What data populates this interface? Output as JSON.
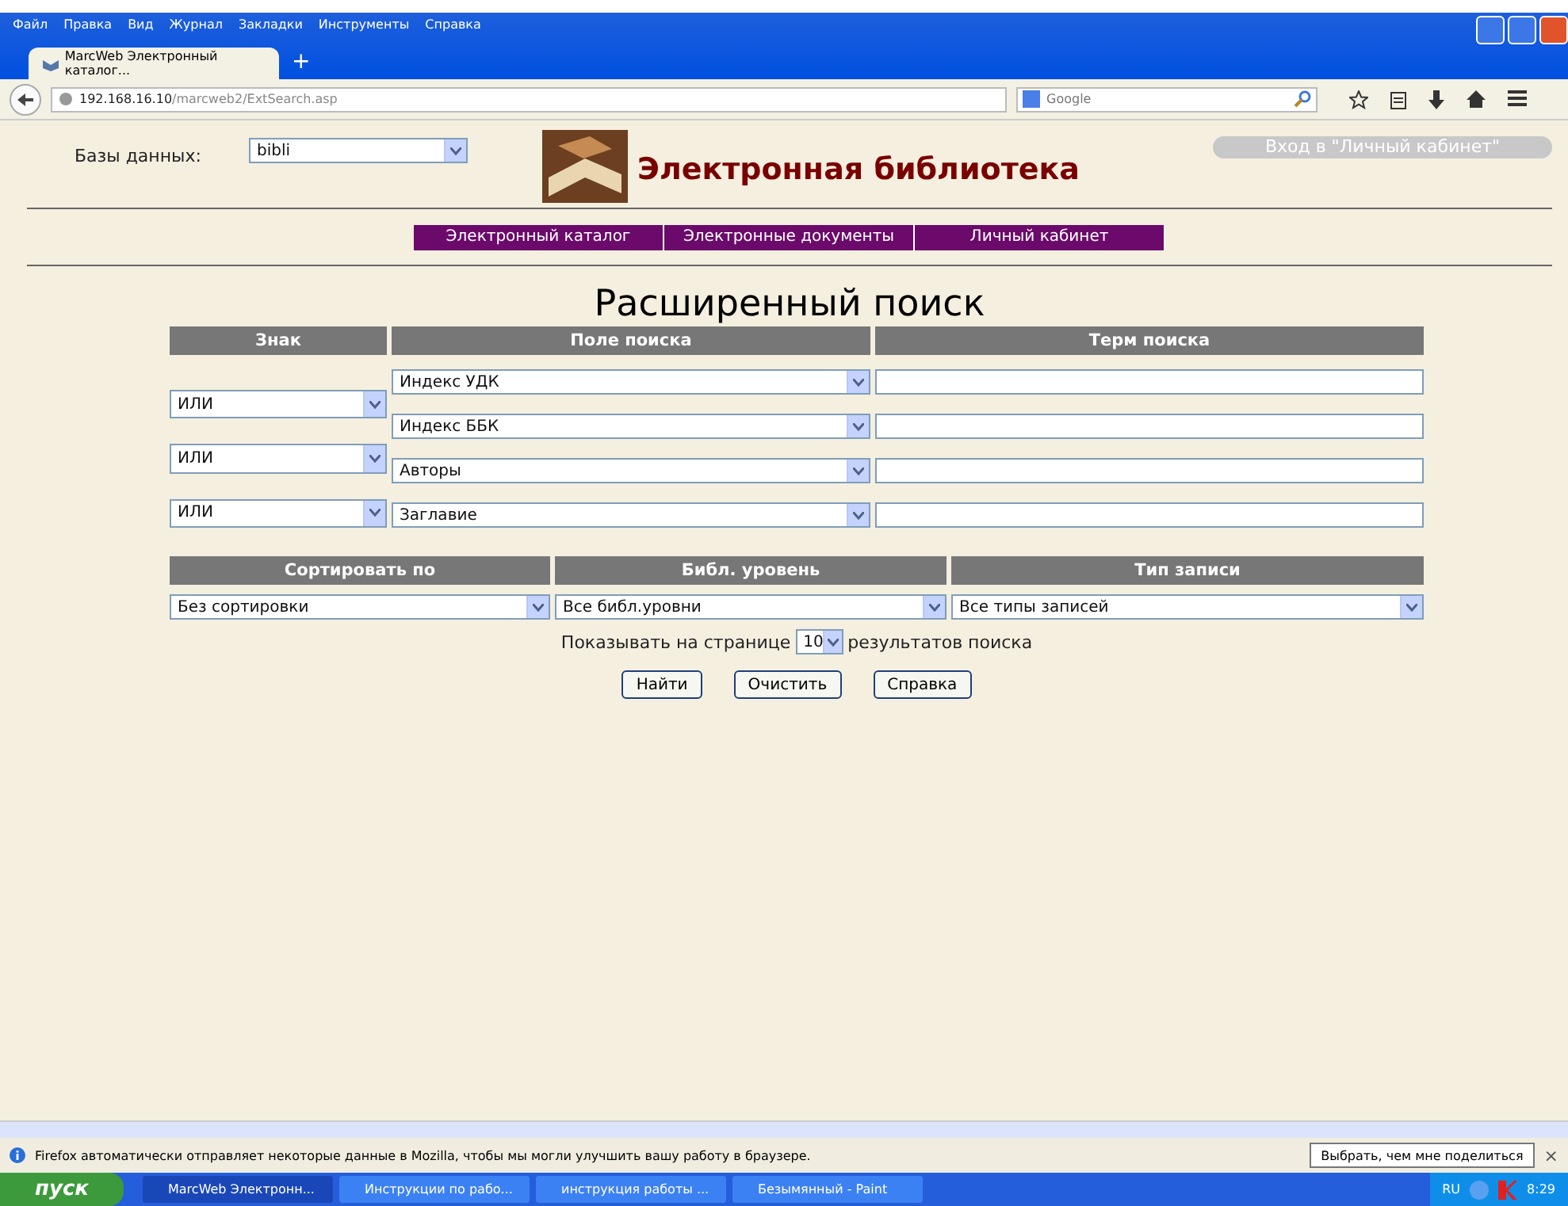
{
  "menu": [
    "Файл",
    "Правка",
    "Вид",
    "Журнал",
    "Закладки",
    "Инструменты",
    "Справка"
  ],
  "tab": {
    "title": "MarcWeb Электронный каталог...",
    "new_tab": "+"
  },
  "address": {
    "host": "192.168.16.10",
    "path": "/marcweb2/ExtSearch.asp"
  },
  "search_engine": {
    "placeholder": "Google"
  },
  "page": {
    "db_label": "Базы данных:",
    "db_value": "bibli",
    "site_title": "Электронная библиотека",
    "login_button": "Вход в \"Личный кабинет\"",
    "nav": [
      {
        "label": "Электронный каталог"
      },
      {
        "label": "Электронные документы"
      },
      {
        "label": "Личный кабинет"
      }
    ],
    "heading": "Расширенный поиск",
    "search_columns": [
      "Знак",
      "Поле поиска",
      "Терм поиска"
    ],
    "operators": [
      "ИЛИ",
      "ИЛИ",
      "ИЛИ"
    ],
    "fields": [
      "Индекс УДК",
      "Индекс ББК",
      "Авторы",
      "Заглавие"
    ],
    "options_columns": [
      "Сортировать по",
      "Библ. уровень",
      "Тип записи"
    ],
    "options_values": [
      "Без сортировки",
      "Все библ.уровни",
      "Все типы записей"
    ],
    "per_page_before": "Показывать на странице",
    "per_page": "10",
    "per_page_after": "результатов поиска",
    "buttons": [
      "Найти",
      "Очистить",
      "Справка"
    ]
  },
  "notification": {
    "text": "Firefox автоматически отправляет некоторые данные в Mozilla, чтобы мы могли улучшить вашу работу в браузере.",
    "button": "Выбрать, чем мне поделиться",
    "close": "×"
  },
  "taskbar": {
    "start": "пуск",
    "tasks": [
      {
        "label": "MarcWeb Электронн...",
        "selected": true
      },
      {
        "label": "Инструкции по рабо...",
        "selected": false
      },
      {
        "label": "инструкция работы ...",
        "selected": false
      },
      {
        "label": "Безымянный - Paint",
        "selected": false
      }
    ],
    "lang": "RU",
    "time": "8:29"
  }
}
